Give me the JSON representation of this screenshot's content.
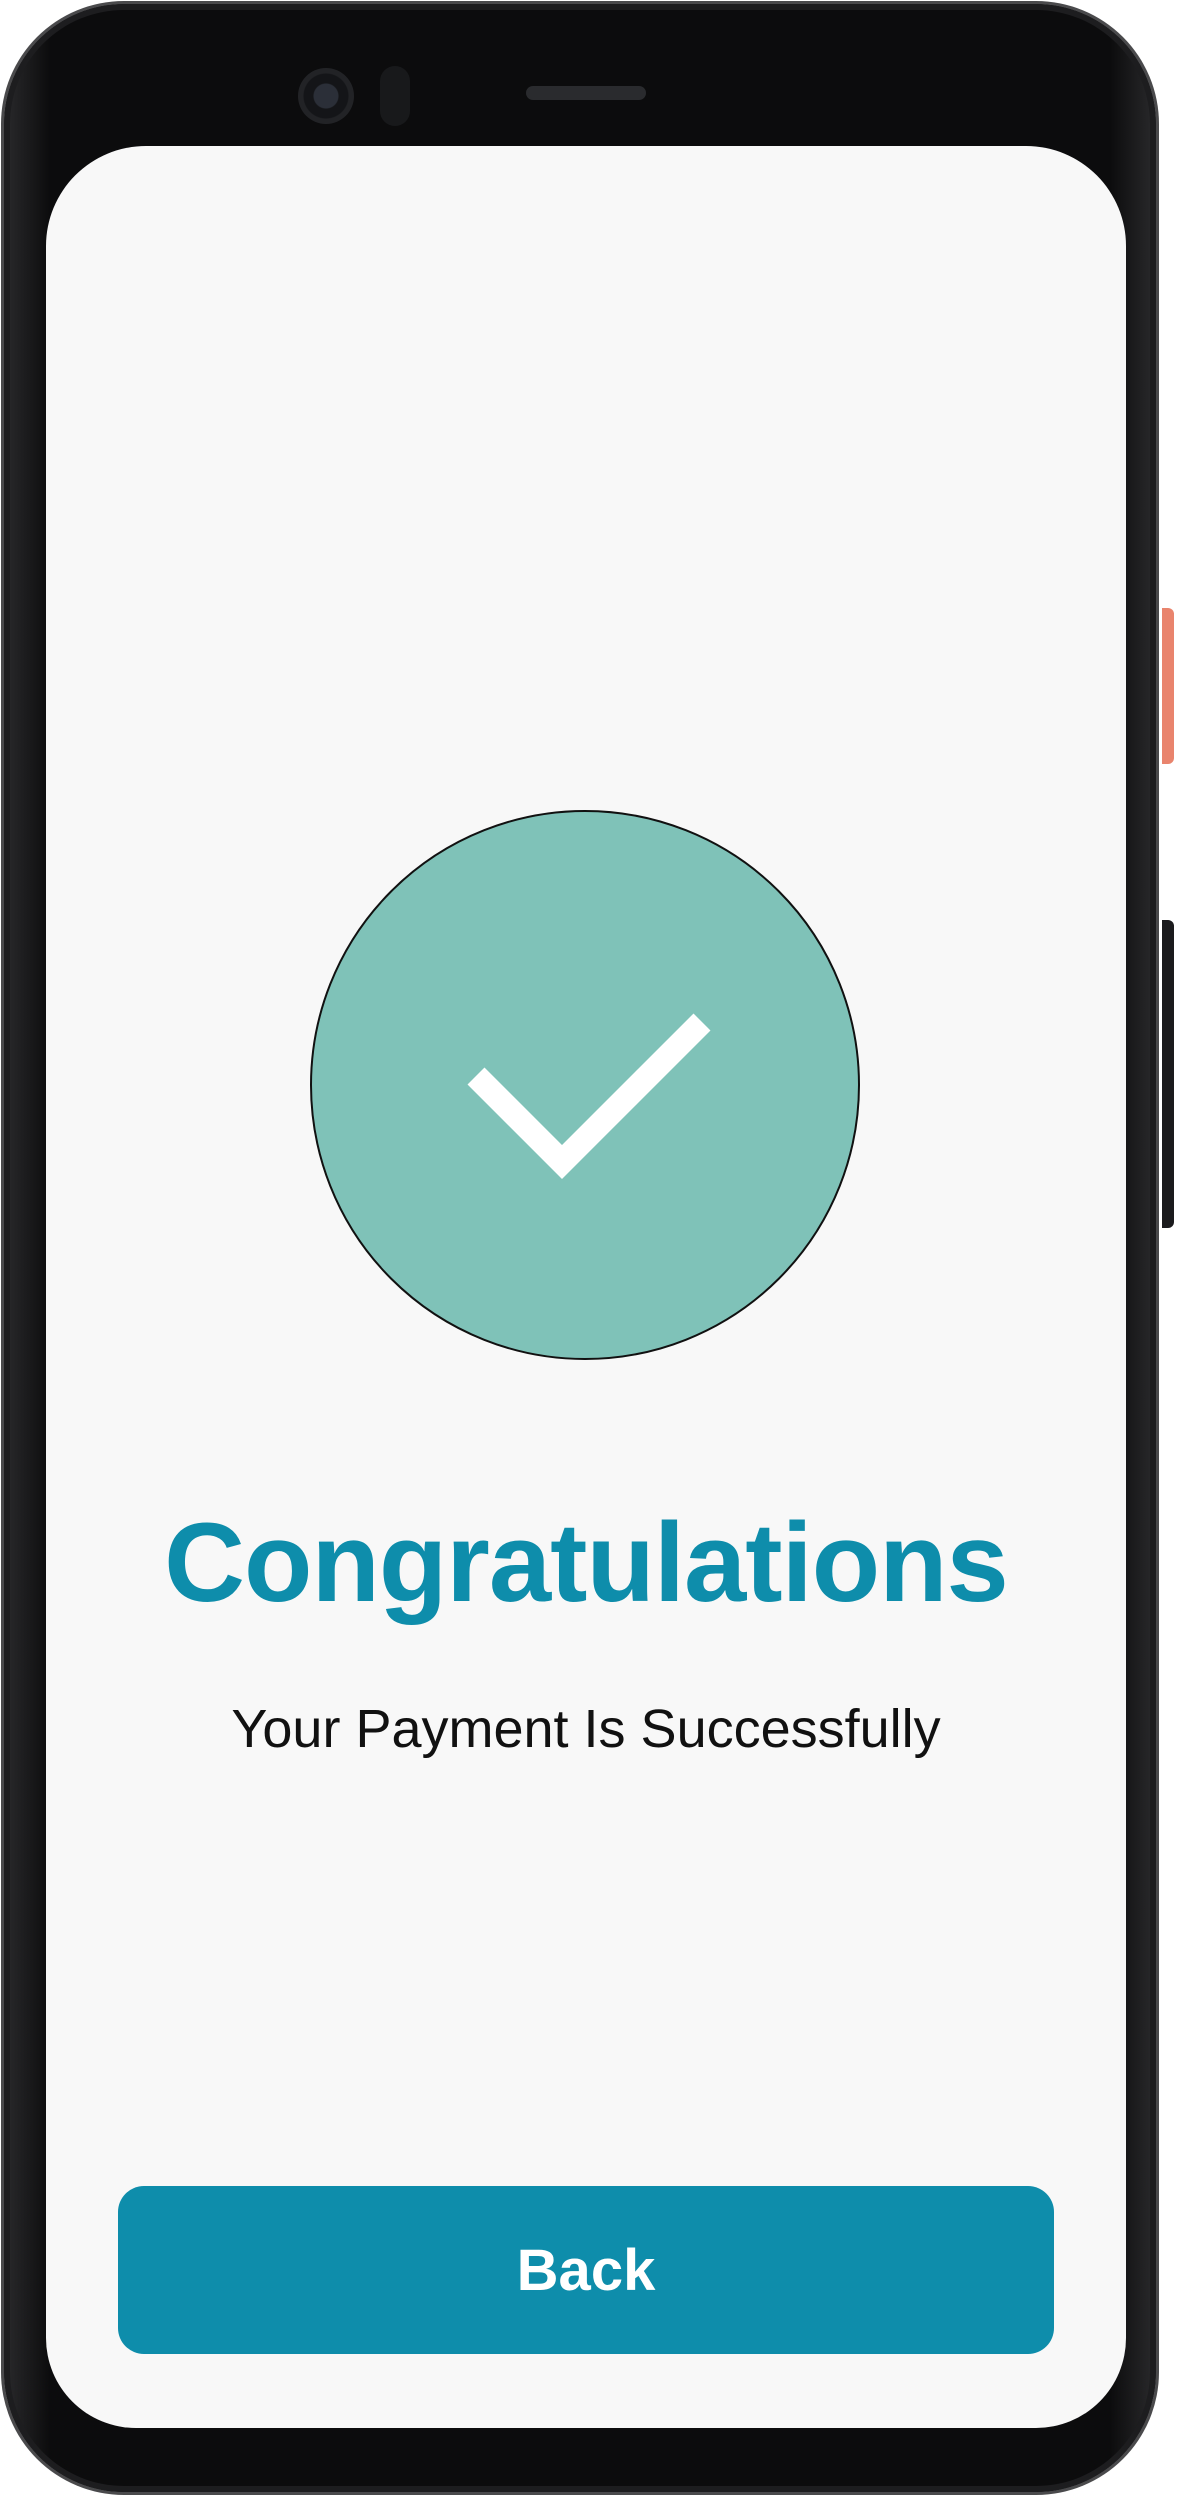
{
  "success": {
    "icon": "checkmark-icon",
    "circle_color": "#7fc2b8",
    "title": "Congratulations",
    "message": "Your Payment Is Successfully"
  },
  "actions": {
    "back_label": "Back"
  },
  "colors": {
    "accent": "#0e8dab",
    "screen_background": "#f8f8f8",
    "text": "#111111"
  }
}
